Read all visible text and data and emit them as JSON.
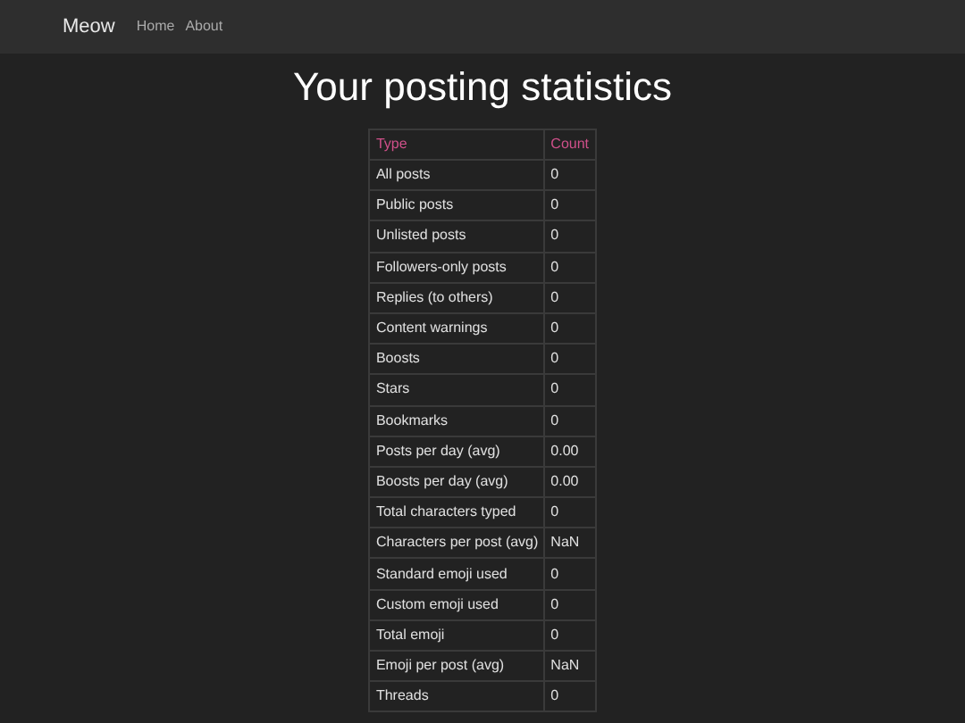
{
  "navbar": {
    "brand": "Meow",
    "links": [
      "Home",
      "About"
    ]
  },
  "title": "Your posting statistics",
  "table": {
    "columns": [
      "Type",
      "Count"
    ],
    "rows": [
      [
        "All posts",
        "0"
      ],
      [
        "Public posts",
        "0"
      ],
      [
        "Unlisted posts",
        "0"
      ],
      [
        "Followers-only posts",
        "0"
      ],
      [
        "Replies (to others)",
        "0"
      ],
      [
        "Content warnings",
        "0"
      ],
      [
        "Boosts",
        "0"
      ],
      [
        "Stars",
        "0"
      ],
      [
        "Bookmarks",
        "0"
      ],
      [
        "Posts per day (avg)",
        "0.00"
      ],
      [
        "Boosts per day (avg)",
        "0.00"
      ],
      [
        "Total characters typed",
        "0"
      ],
      [
        "Characters per post (avg)",
        "NaN"
      ],
      [
        "Standard emoji used",
        "0"
      ],
      [
        "Custom emoji used",
        "0"
      ],
      [
        "Total emoji",
        "0"
      ],
      [
        "Emoji per post (avg)",
        "NaN"
      ],
      [
        "Threads",
        "0"
      ]
    ]
  }
}
